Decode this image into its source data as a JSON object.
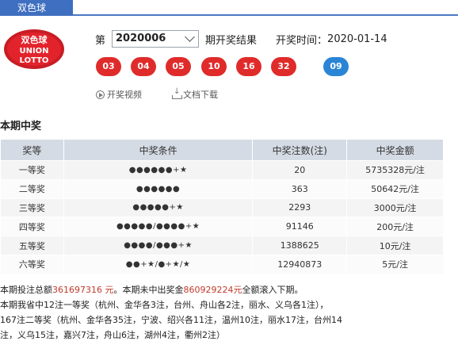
{
  "tab": {
    "label": "双色球"
  },
  "logo": {
    "line1": "双色球",
    "line2": "UNION",
    "line3": "LOTTO"
  },
  "issue": {
    "prefix": "第",
    "selected": "2020006",
    "suffix": "期开奖结果",
    "time_label": "开奖时间：",
    "time_value": "2020-01-14"
  },
  "balls": {
    "red": [
      "03",
      "04",
      "05",
      "10",
      "16",
      "32"
    ],
    "blue": [
      "09"
    ]
  },
  "links": {
    "video": "开奖视频",
    "download": "文档下载"
  },
  "section": {
    "title": "本期中奖"
  },
  "table": {
    "headers": [
      "奖等",
      "中奖条件",
      "中奖注数(注)",
      "中奖金额"
    ],
    "rows": [
      [
        "一等奖",
        "●●●●●●+★",
        "20",
        "5735328元/注"
      ],
      [
        "二等奖",
        "●●●●●●",
        "363",
        "50642元/注"
      ],
      [
        "三等奖",
        "●●●●●+★",
        "2293",
        "3000元/注"
      ],
      [
        "四等奖",
        "●●●●●/●●●●+★",
        "91146",
        "200元/注"
      ],
      [
        "五等奖",
        "●●●●/●●●+★",
        "1388625",
        "10元/注"
      ],
      [
        "六等奖",
        "●●+★/●+★/★",
        "12940873",
        "5元/注"
      ]
    ]
  },
  "summary": {
    "l1_a": "本期投注总额",
    "l1_num1": "361697316 元",
    "l1_b": "。本期未中出奖金",
    "l1_num2": "860929224元",
    "l1_c": "全额滚入下期。",
    "l2": "本期我省中12注一等奖（杭州、金华各3注，台州、舟山各2注，丽水、义乌各1注），",
    "l3": "167注二等奖（杭州、金华各35注，宁波、绍兴各11注，温州10注，丽水17注，台州14",
    "l4": "注，义乌15注，嘉兴7注，舟山6注，湖州4注，衢州2注）"
  },
  "colors": {
    "tab": "#3f6fc0",
    "red_ball": "#e02b2b",
    "blue_ball": "#2b85d6",
    "highlight": "#c0392b"
  }
}
